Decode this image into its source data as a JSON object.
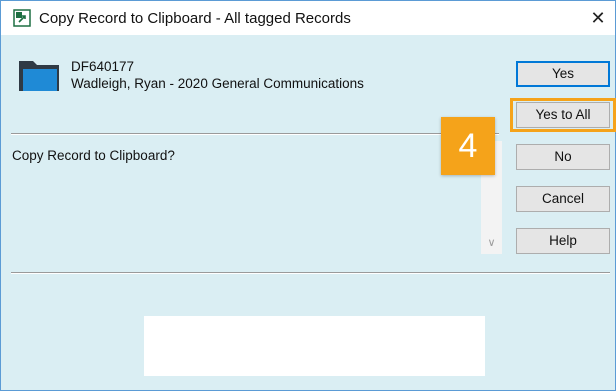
{
  "window": {
    "title": "Copy Record to Clipboard - All tagged Records",
    "close_glyph": "✕",
    "icon": "copy-to-clipboard-icon"
  },
  "record": {
    "icon": "folder-icon",
    "id": "DF640177",
    "title": "Wadleigh, Ryan - 2020 General Communications"
  },
  "message": "Copy Record to Clipboard?",
  "scrollbar": {
    "down_glyph": "∨"
  },
  "step_badge": {
    "text": "4",
    "color": "#f5a31a"
  },
  "buttons": {
    "yes": "Yes",
    "yes_to_all": "Yes to All",
    "no": "No",
    "cancel": "Cancel",
    "help": "Help"
  },
  "colors": {
    "dialog_background": "#daeef3",
    "focus_border": "#0078d7",
    "highlight": "#f5a31a"
  }
}
